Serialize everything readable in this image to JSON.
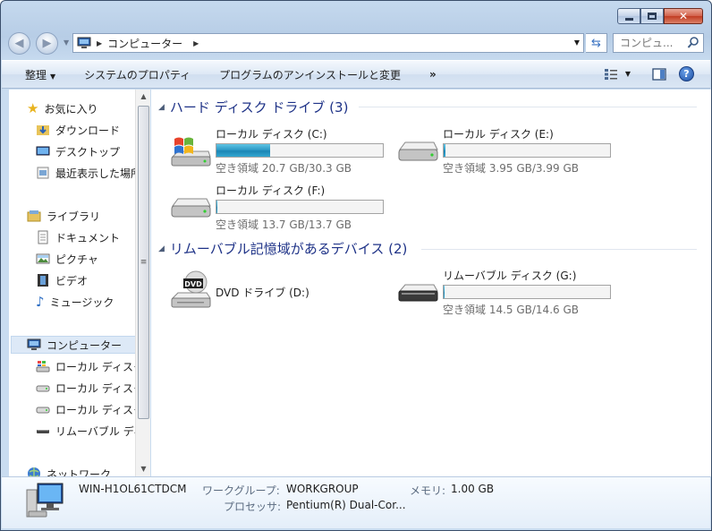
{
  "address": {
    "crumb": "コンピューター"
  },
  "search": {
    "placeholder": "コンピュ..."
  },
  "commands": [
    {
      "label": "整理",
      "has_menu": true
    },
    {
      "label": "システムのプロパティ"
    },
    {
      "label": "プログラムのアンインストールと変更"
    },
    {
      "label": "»"
    }
  ],
  "nav": {
    "favorites": {
      "label": "お気に入り",
      "items": [
        "ダウンロード",
        "デスクトップ",
        "最近表示した場所"
      ]
    },
    "libraries": {
      "label": "ライブラリ",
      "items": [
        "ドキュメント",
        "ピクチャ",
        "ビデオ",
        "ミュージック"
      ]
    },
    "computer": {
      "label": "コンピューター",
      "items": [
        "ローカル ディスク (C:)",
        "ローカル ディスク (E:)",
        "ローカル ディスク (F:)",
        "リムーバブル ディスク (G:)"
      ]
    },
    "network": {
      "label": "ネットワーク"
    }
  },
  "groups": {
    "hdd": {
      "title": "ハード ディスク ドライブ (3)",
      "drives": [
        {
          "name": "ローカル ディスク (C:)",
          "info": "空き領域 20.7 GB/30.3 GB",
          "used_fraction": 0.32,
          "icon": "windows-drive-icon"
        },
        {
          "name": "ローカル ディスク (E:)",
          "info": "空き領域 3.95 GB/3.99 GB",
          "used_fraction": 0.01,
          "icon": "hard-drive-icon"
        },
        {
          "name": "ローカル ディスク (F:)",
          "info": "空き領域 13.7 GB/13.7 GB",
          "used_fraction": 0.005,
          "icon": "hard-drive-icon"
        }
      ]
    },
    "removable": {
      "title": "リムーバブル記憶域があるデバイス (2)",
      "dvd": {
        "name": "DVD ドライブ (D:)",
        "icon": "dvd-drive-icon"
      },
      "usb": {
        "name": "リムーバブル ディスク (G:)",
        "info": "空き領域 14.5 GB/14.6 GB",
        "used_fraction": 0.0,
        "icon": "removable-drive-icon"
      }
    }
  },
  "details": {
    "computer_name": "WIN-H1OL61CTDCM",
    "workgroup_label": "ワークグループ:",
    "workgroup": "WORKGROUP",
    "memory_label": "メモリ:",
    "memory": "1.00 GB",
    "processor_label": "プロセッサ:",
    "processor": "Pentium(R) Dual-Cor..."
  },
  "colors": {
    "accent": "#1e3287",
    "bar_fill": "#2e9ac6"
  }
}
